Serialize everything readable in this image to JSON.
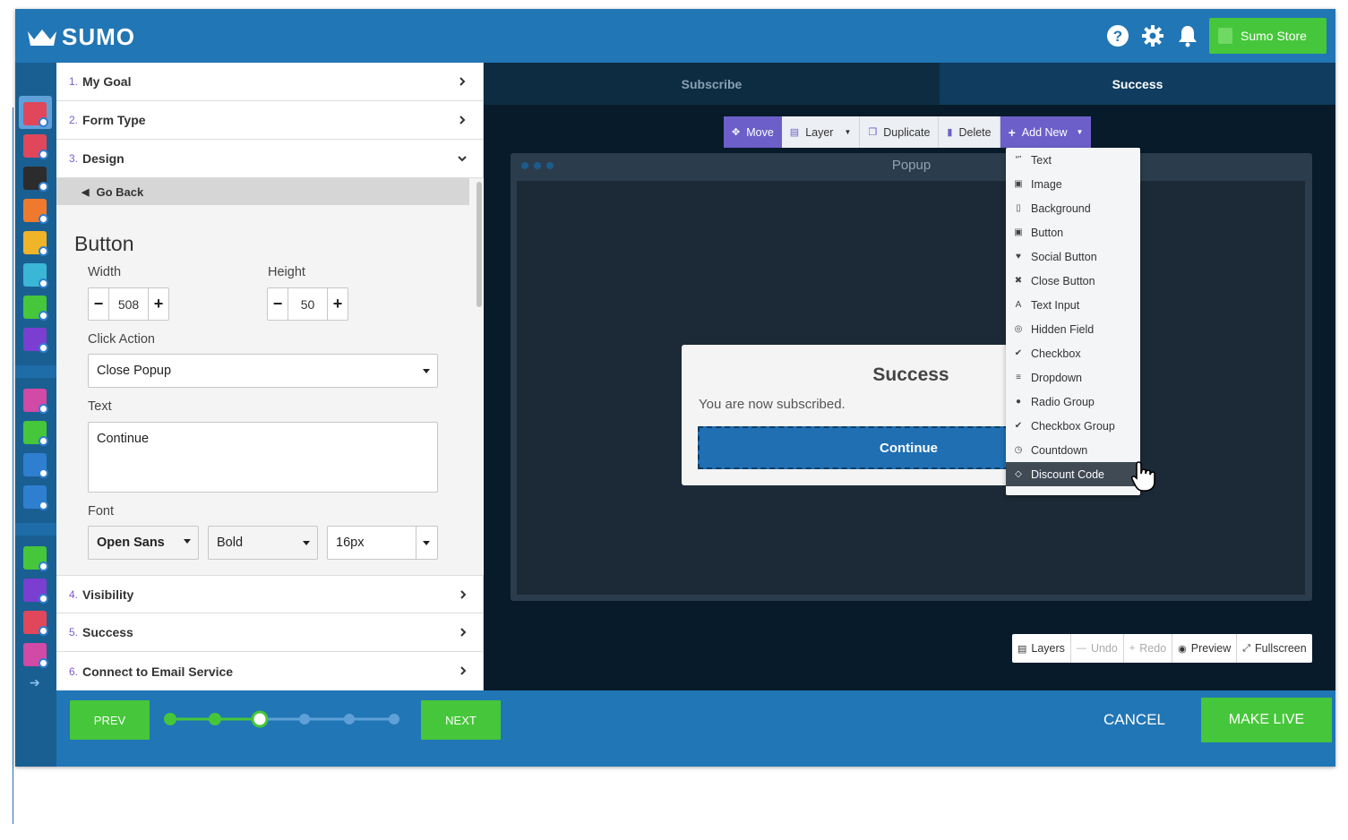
{
  "app": {
    "logo_text": "SUMO",
    "store_label": "Sumo Store"
  },
  "topbar": {
    "icons": [
      "help-icon",
      "gear-icon",
      "bell-icon"
    ]
  },
  "accordion": [
    {
      "num": "1.",
      "label": "My Goal"
    },
    {
      "num": "2.",
      "label": "Form Type"
    },
    {
      "num": "3.",
      "label": "Design"
    }
  ],
  "design": {
    "go_back": "Go Back",
    "heading": "Button",
    "width_label": "Width",
    "width_value": "508",
    "height_label": "Height",
    "height_value": "50",
    "click_action_label": "Click Action",
    "click_action_value": "Close Popup",
    "text_label": "Text",
    "text_value": "Continue",
    "font_label": "Font",
    "font_family": "Open Sans",
    "font_weight": "Bold",
    "font_size": "16px"
  },
  "lower_accordion": [
    {
      "num": "4.",
      "label": "Visibility"
    },
    {
      "num": "5.",
      "label": "Success"
    },
    {
      "num": "6.",
      "label": "Connect to Email Service"
    }
  ],
  "bottom": {
    "prev": "PREV",
    "next": "NEXT",
    "cancel": "CANCEL",
    "make_live": "MAKE LIVE",
    "steps_total": 6,
    "current_step": 3
  },
  "tabs": [
    {
      "label": "Subscribe",
      "active": false
    },
    {
      "label": "Success",
      "active": true
    }
  ],
  "toolbar": {
    "move": "Move",
    "layer": "Layer",
    "duplicate": "Duplicate",
    "delete": "Delete",
    "add_new": "Add New"
  },
  "canvas": {
    "frame_title": "Popup",
    "popup_title": "Success",
    "popup_message": "You are now subscribed.",
    "popup_button": "Continue"
  },
  "add_new_menu": [
    {
      "icon": "quote-icon",
      "glyph": "“”",
      "label": "Text"
    },
    {
      "icon": "image-icon",
      "glyph": "▣",
      "label": "Image"
    },
    {
      "icon": "file-icon",
      "glyph": "▯",
      "label": "Background"
    },
    {
      "icon": "image-icon",
      "glyph": "▣",
      "label": "Button"
    },
    {
      "icon": "twitter-icon",
      "glyph": "♥",
      "label": "Social Button"
    },
    {
      "icon": "close-icon",
      "glyph": "✖",
      "label": "Close Button"
    },
    {
      "icon": "text-underline-icon",
      "glyph": "A",
      "label": "Text Input"
    },
    {
      "icon": "eye-icon",
      "glyph": "◎",
      "label": "Hidden Field"
    },
    {
      "icon": "check-icon",
      "glyph": "✔",
      "label": "Checkbox"
    },
    {
      "icon": "list-icon",
      "glyph": "≡",
      "label": "Dropdown"
    },
    {
      "icon": "radio-icon",
      "glyph": "●",
      "label": "Radio Group"
    },
    {
      "icon": "check-icon",
      "glyph": "✔",
      "label": "Checkbox Group"
    },
    {
      "icon": "clock-icon",
      "glyph": "◷",
      "label": "Countdown"
    },
    {
      "icon": "tag-icon",
      "glyph": "◇",
      "label": "Discount Code"
    }
  ],
  "bottom_tools": [
    {
      "label": "Layers",
      "icon": "layers-icon",
      "glyph": "▤",
      "disabled": false
    },
    {
      "label": "Undo",
      "icon": "undo-icon",
      "glyph": "—",
      "disabled": true
    },
    {
      "label": "Redo",
      "icon": "redo-icon",
      "glyph": "+",
      "disabled": true
    },
    {
      "label": "Preview",
      "icon": "eye-icon",
      "glyph": "◉",
      "disabled": false
    },
    {
      "label": "Fullscreen",
      "icon": "expand-icon",
      "glyph": "⤢",
      "disabled": false
    }
  ],
  "colors": {
    "brand_blue": "#2176b5",
    "green": "#46c63a",
    "purple": "#6c5fc9",
    "editor_bg": "#071b2b"
  }
}
